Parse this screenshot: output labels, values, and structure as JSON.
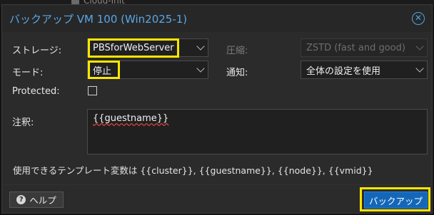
{
  "background": {
    "item_label": "Cloud-Init"
  },
  "dialog": {
    "title": "バックアップ VM 100 (Win2025-1)",
    "close_icon": "close-icon",
    "fields": {
      "storage_label": "ストレージ:",
      "storage_value": "PBSforWebServer",
      "compression_label": "圧縮:",
      "compression_value": "ZSTD (fast and good)",
      "mode_label": "モード:",
      "mode_value": "停止",
      "notification_label": "通知:",
      "notification_value": "全体の設定を使用",
      "protected_label": "Protected:",
      "protected_checked": false,
      "notes_label": "注釈:",
      "notes_value": "{{guestname}}"
    },
    "hint": "使用できるテンプレート変数は {{cluster}}, {{guestname}}, {{node}}, {{vmid}}",
    "buttons": {
      "help_label": "ヘルプ",
      "help_icon": "question-circle-icon",
      "backup_label": "バックアップ"
    },
    "colors": {
      "title": "#5aa6e6",
      "primary_button": "#1467b8",
      "highlight": "#ffe600"
    }
  }
}
